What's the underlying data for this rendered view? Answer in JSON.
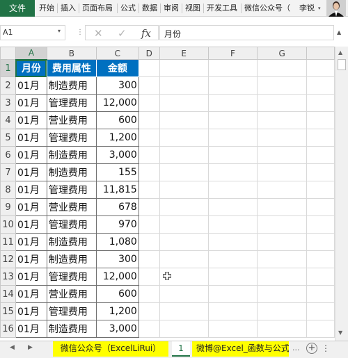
{
  "ribbon": {
    "file": "文件",
    "tabs": [
      "开始",
      "插入",
      "页面布局",
      "公式",
      "数据",
      "审阅",
      "视图",
      "开发工具",
      "微信公众号（"
    ],
    "user": "李锐",
    "user_caret": "▾"
  },
  "formula_bar": {
    "name_box": "A1",
    "name_caret": "▾",
    "cancel_icon": "✕",
    "enter_icon": "✓",
    "fx_label": "fx",
    "formula": "月份"
  },
  "columns": [
    "A",
    "B",
    "C",
    "D",
    "E",
    "F",
    "G"
  ],
  "rows": [
    "1",
    "2",
    "3",
    "4",
    "5",
    "6",
    "7",
    "8",
    "9",
    "10",
    "11",
    "12",
    "13",
    "14",
    "15",
    "16"
  ],
  "table": {
    "headers": [
      "月份",
      "费用属性",
      "金额"
    ],
    "data": [
      [
        "01月",
        "制造费用",
        "300"
      ],
      [
        "01月",
        "管理费用",
        "12,000"
      ],
      [
        "01月",
        "营业费用",
        "600"
      ],
      [
        "01月",
        "管理费用",
        "1,200"
      ],
      [
        "01月",
        "制造费用",
        "3,000"
      ],
      [
        "01月",
        "制造费用",
        "155"
      ],
      [
        "01月",
        "管理费用",
        "11,815"
      ],
      [
        "01月",
        "营业费用",
        "678"
      ],
      [
        "01月",
        "管理费用",
        "970"
      ],
      [
        "01月",
        "制造费用",
        "1,080"
      ],
      [
        "01月",
        "制造费用",
        "300"
      ],
      [
        "01月",
        "管理费用",
        "12,000"
      ],
      [
        "01月",
        "营业费用",
        "600"
      ],
      [
        "01月",
        "管理费用",
        "1,200"
      ],
      [
        "01月",
        "制造费用",
        "3,000"
      ]
    ]
  },
  "sheet_tabs": {
    "wechat": "微信公众号（ExcelLiRui）",
    "active": "1",
    "weibo": "微博@Excel_函数与公式",
    "dots": "...",
    "add": "+"
  },
  "colors": {
    "header_fill": "#0070c0",
    "accent": "#217346",
    "tab_highlight": "#ffff00"
  }
}
